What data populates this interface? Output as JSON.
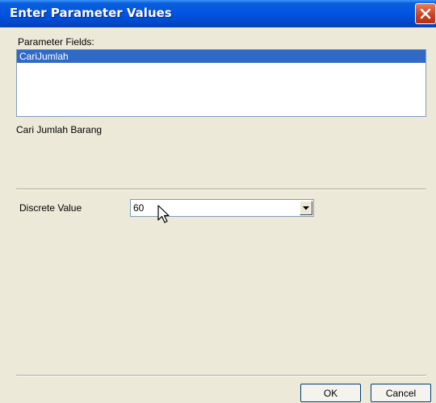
{
  "dialog": {
    "title": "Enter Parameter Values",
    "param_fields_label": "Parameter Fields:",
    "param_fields": [
      "CariJumlah"
    ],
    "prompt_text": "Cari Jumlah Barang",
    "discrete_label": "Discrete Value",
    "discrete_value": "60",
    "ok_label": "OK",
    "cancel_label": "Cancel"
  },
  "icons": {
    "close": "close-icon",
    "dropdown": "chevron-down-icon",
    "cursor": "mouse-cursor-icon"
  },
  "colors": {
    "title_bar": "#0054e3",
    "close_button": "#c7401f",
    "selection": "#316ac5",
    "dialog_background": "#ece9d8"
  }
}
